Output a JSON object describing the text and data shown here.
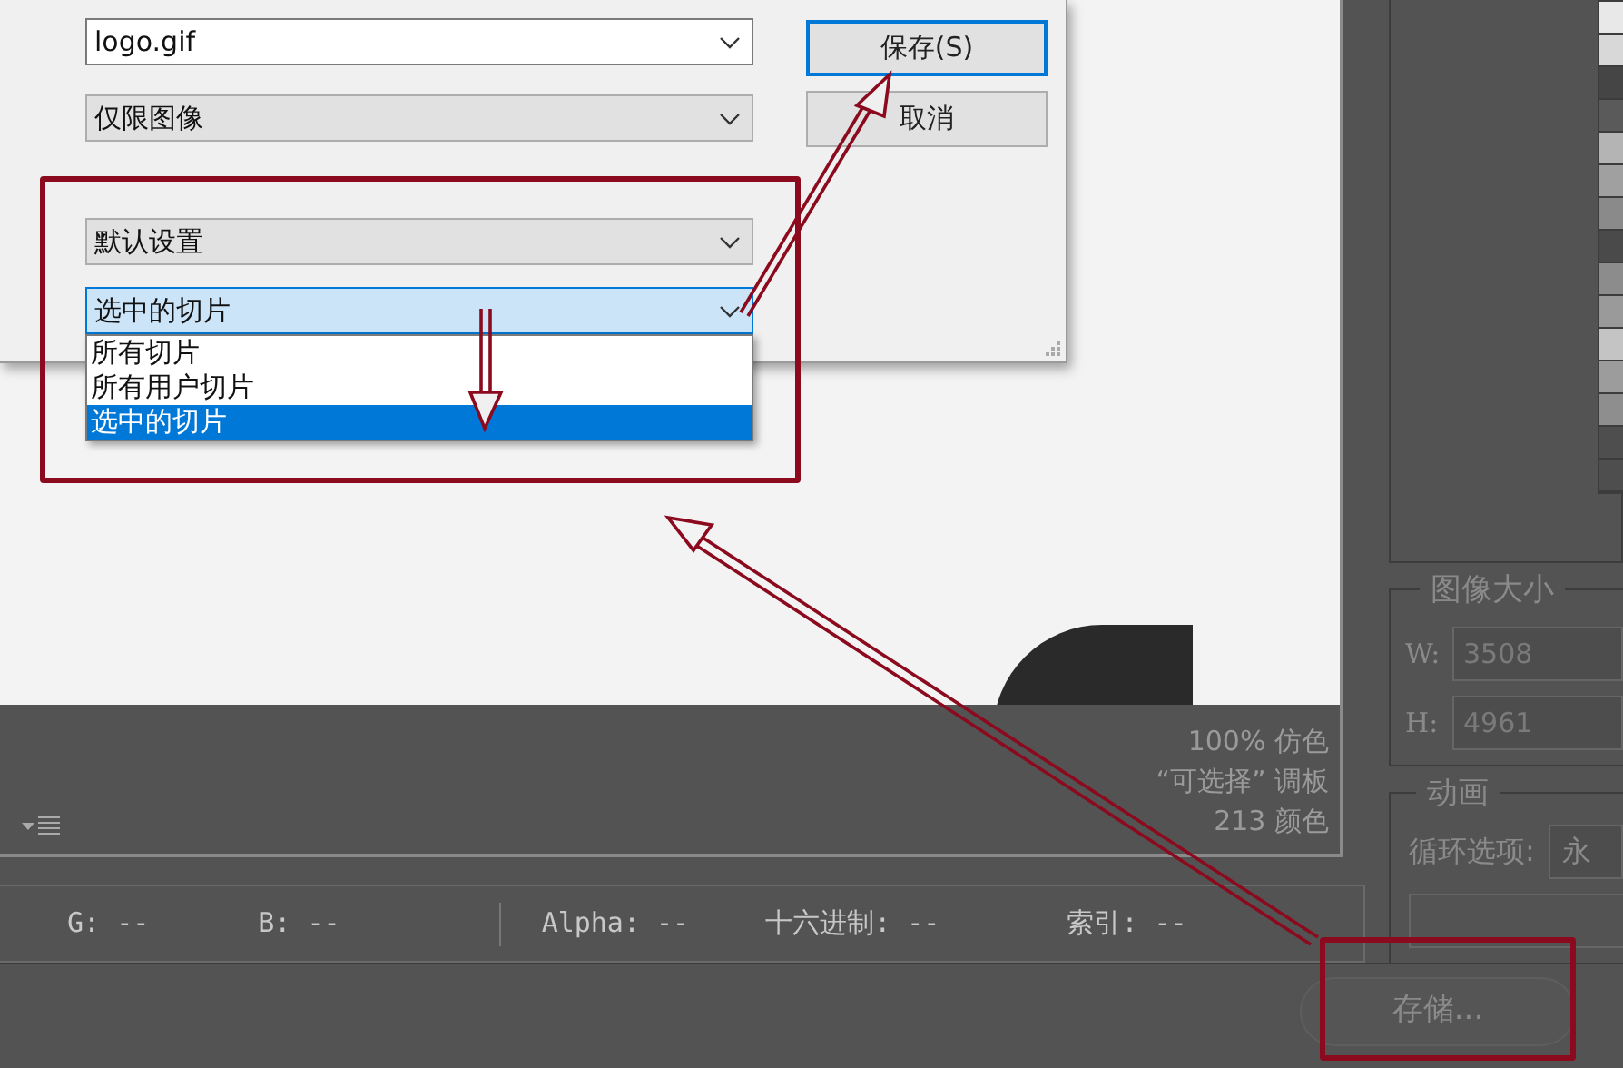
{
  "dialog": {
    "filename": "logo.gif",
    "format": "仅限图像",
    "settings": "默认设置",
    "slices": {
      "value": "选中的切片",
      "expanded": true,
      "options": [
        {
          "label": "所有切片",
          "selected": false
        },
        {
          "label": "所有用户切片",
          "selected": false
        },
        {
          "label": "选中的切片",
          "selected": true
        }
      ]
    },
    "buttons": [
      {
        "label": "保存(S)",
        "default": true
      },
      {
        "label": "取消",
        "default": false
      }
    ]
  },
  "preview": {
    "info": [
      "100% 仿色",
      "“可选择” 调板",
      "213 颜色"
    ]
  },
  "info_bar": [
    {
      "label": "G:",
      "value": "--"
    },
    {
      "label": "B:",
      "value": "--"
    },
    {
      "label": "Alpha:",
      "value": "--"
    },
    {
      "label": "十六进制:",
      "value": "--"
    },
    {
      "label": "索引:",
      "value": "--"
    }
  ],
  "color_table": [
    {
      "color": "#e8e8e8"
    },
    {
      "color": "#d8d8d8"
    },
    {
      "color": "#454545"
    },
    {
      "color": "#5a5a5a"
    },
    {
      "color": "#b4b4b4"
    },
    {
      "color": "#a0a0a0"
    },
    {
      "color": "#8a8a8a"
    },
    {
      "color": "#4a4a4a"
    },
    {
      "color": "#8c8c8c"
    },
    {
      "color": "#9a9a9a"
    },
    {
      "color": "#c4c4c4"
    },
    {
      "color": "#9c9c9c"
    },
    {
      "color": "#8e8e8e"
    },
    {
      "color": "#4e4e4e"
    },
    {
      "color": "#4e4e4e"
    }
  ],
  "image_size": {
    "title": "图像大小",
    "fields": [
      {
        "label": "W:",
        "value": "3508"
      },
      {
        "label": "H:",
        "value": "4961"
      }
    ]
  },
  "animation": {
    "title": "动画",
    "loop_label": "循环选项:",
    "loop_value": "永"
  },
  "save_button": "存储..."
}
